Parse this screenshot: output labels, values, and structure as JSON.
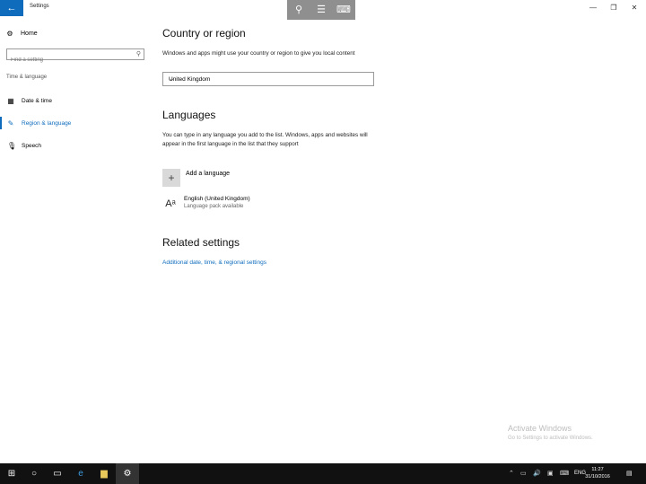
{
  "window": {
    "title": "Settings",
    "back_icon": "back-arrow-icon",
    "minimize": "—",
    "restore": "❐",
    "close": "✕"
  },
  "magnifier": {
    "icons": [
      "zoom-icon",
      "view-icon",
      "keyboard-icon"
    ]
  },
  "sidebar": {
    "home": "Home",
    "search_placeholder": "Find a setting",
    "group": "Time & language",
    "items": [
      {
        "label": "Date & time",
        "icon": "calendar-clock-icon",
        "active": false
      },
      {
        "label": "Region & language",
        "icon": "region-language-icon",
        "active": true
      },
      {
        "label": "Speech",
        "icon": "microphone-icon",
        "active": false
      }
    ]
  },
  "main": {
    "country_title": "Country or region",
    "country_desc": "Windows and apps might use your country or region to give you local content",
    "country_value": "United Kingdom",
    "languages_title": "Languages",
    "languages_desc": "You can type in any language you add to the list. Windows, apps and websites will appear in the first language in the list that they support",
    "add_language": "Add a language",
    "language_name": "English (United Kingdom)",
    "language_status": "Language pack available",
    "related_title": "Related settings",
    "related_link": "Additional date, time, & regional settings"
  },
  "watermark": {
    "line1": "Activate Windows",
    "line2": "Go to Settings to activate Windows."
  },
  "taskbar": {
    "icons": [
      "start-icon",
      "search-icon",
      "task-view-icon",
      "edge-icon",
      "file-explorer-icon",
      "settings-icon"
    ],
    "lang": "ENG",
    "time": "11:27",
    "date": "31/10/2016"
  },
  "colors": {
    "accent": "#0f6cbd",
    "taskbar": "#111111"
  }
}
